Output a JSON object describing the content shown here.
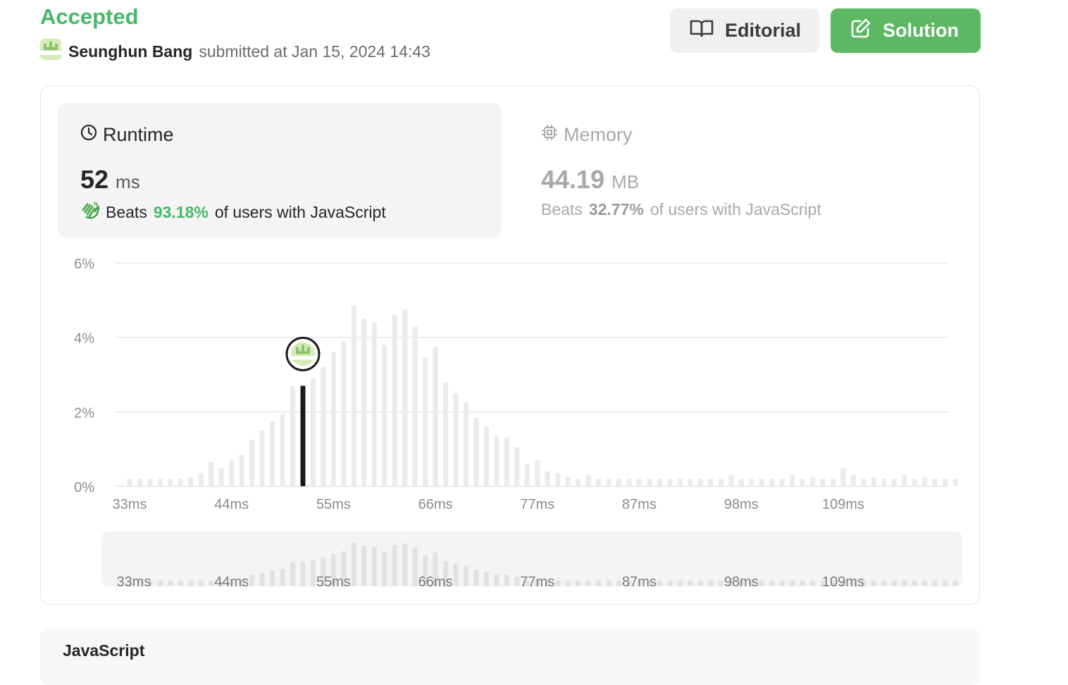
{
  "submission": {
    "status": "Accepted",
    "username": "Seunghun Bang",
    "submitted_text": "submitted at Jan 15, 2024 14:43"
  },
  "buttons": {
    "editorial": "Editorial",
    "solution": "Solution"
  },
  "runtime": {
    "label": "Runtime",
    "value": "52",
    "unit": "ms",
    "beats_prefix": "Beats",
    "beats_pct": "93.18%",
    "beats_suffix": "of users with JavaScript"
  },
  "memory": {
    "label": "Memory",
    "value": "44.19",
    "unit": "MB",
    "beats_prefix": "Beats",
    "beats_pct": "32.77%",
    "beats_suffix": "of users with JavaScript"
  },
  "language": "JavaScript",
  "colors": {
    "accent_green": "#45b86a",
    "solution_button": "#5db863",
    "bar": "#ebebeb",
    "user_bar": "#1a1a1a"
  },
  "chart_data": {
    "type": "bar",
    "title": "",
    "xlabel": "",
    "ylabel": "",
    "ylim": [
      0,
      6
    ],
    "y_ticks": [
      "0%",
      "2%",
      "4%",
      "6%"
    ],
    "x_tick_labels": [
      "33ms",
      "44ms",
      "55ms",
      "66ms",
      "77ms",
      "87ms",
      "98ms",
      "109ms"
    ],
    "x_ticks_at_bar_index": [
      0,
      10,
      20,
      30,
      40,
      50,
      60,
      70
    ],
    "grid": true,
    "highlight_index": 17,
    "highlight_value_ms": 52,
    "values": [
      0.2,
      0.2,
      0.2,
      0.2,
      0.2,
      0.2,
      0.25,
      0.35,
      0.65,
      0.5,
      0.7,
      0.85,
      1.25,
      1.5,
      1.75,
      1.95,
      2.7,
      2.7,
      2.9,
      3.2,
      3.6,
      3.9,
      4.85,
      4.5,
      4.4,
      3.8,
      4.6,
      4.75,
      4.3,
      3.45,
      3.75,
      2.8,
      2.5,
      2.25,
      1.85,
      1.6,
      1.35,
      1.3,
      1.05,
      0.6,
      0.7,
      0.4,
      0.35,
      0.25,
      0.2,
      0.3,
      0.2,
      0.2,
      0.2,
      0.2,
      0.2,
      0.2,
      0.2,
      0.2,
      0.2,
      0.2,
      0.2,
      0.2,
      0.2,
      0.3,
      0.2,
      0.2,
      0.2,
      0.2,
      0.2,
      0.3,
      0.2,
      0.25,
      0.2,
      0.2,
      0.5,
      0.3,
      0.2,
      0.25,
      0.2,
      0.2,
      0.3,
      0.2,
      0.25,
      0.2,
      0.2,
      0.2
    ]
  }
}
